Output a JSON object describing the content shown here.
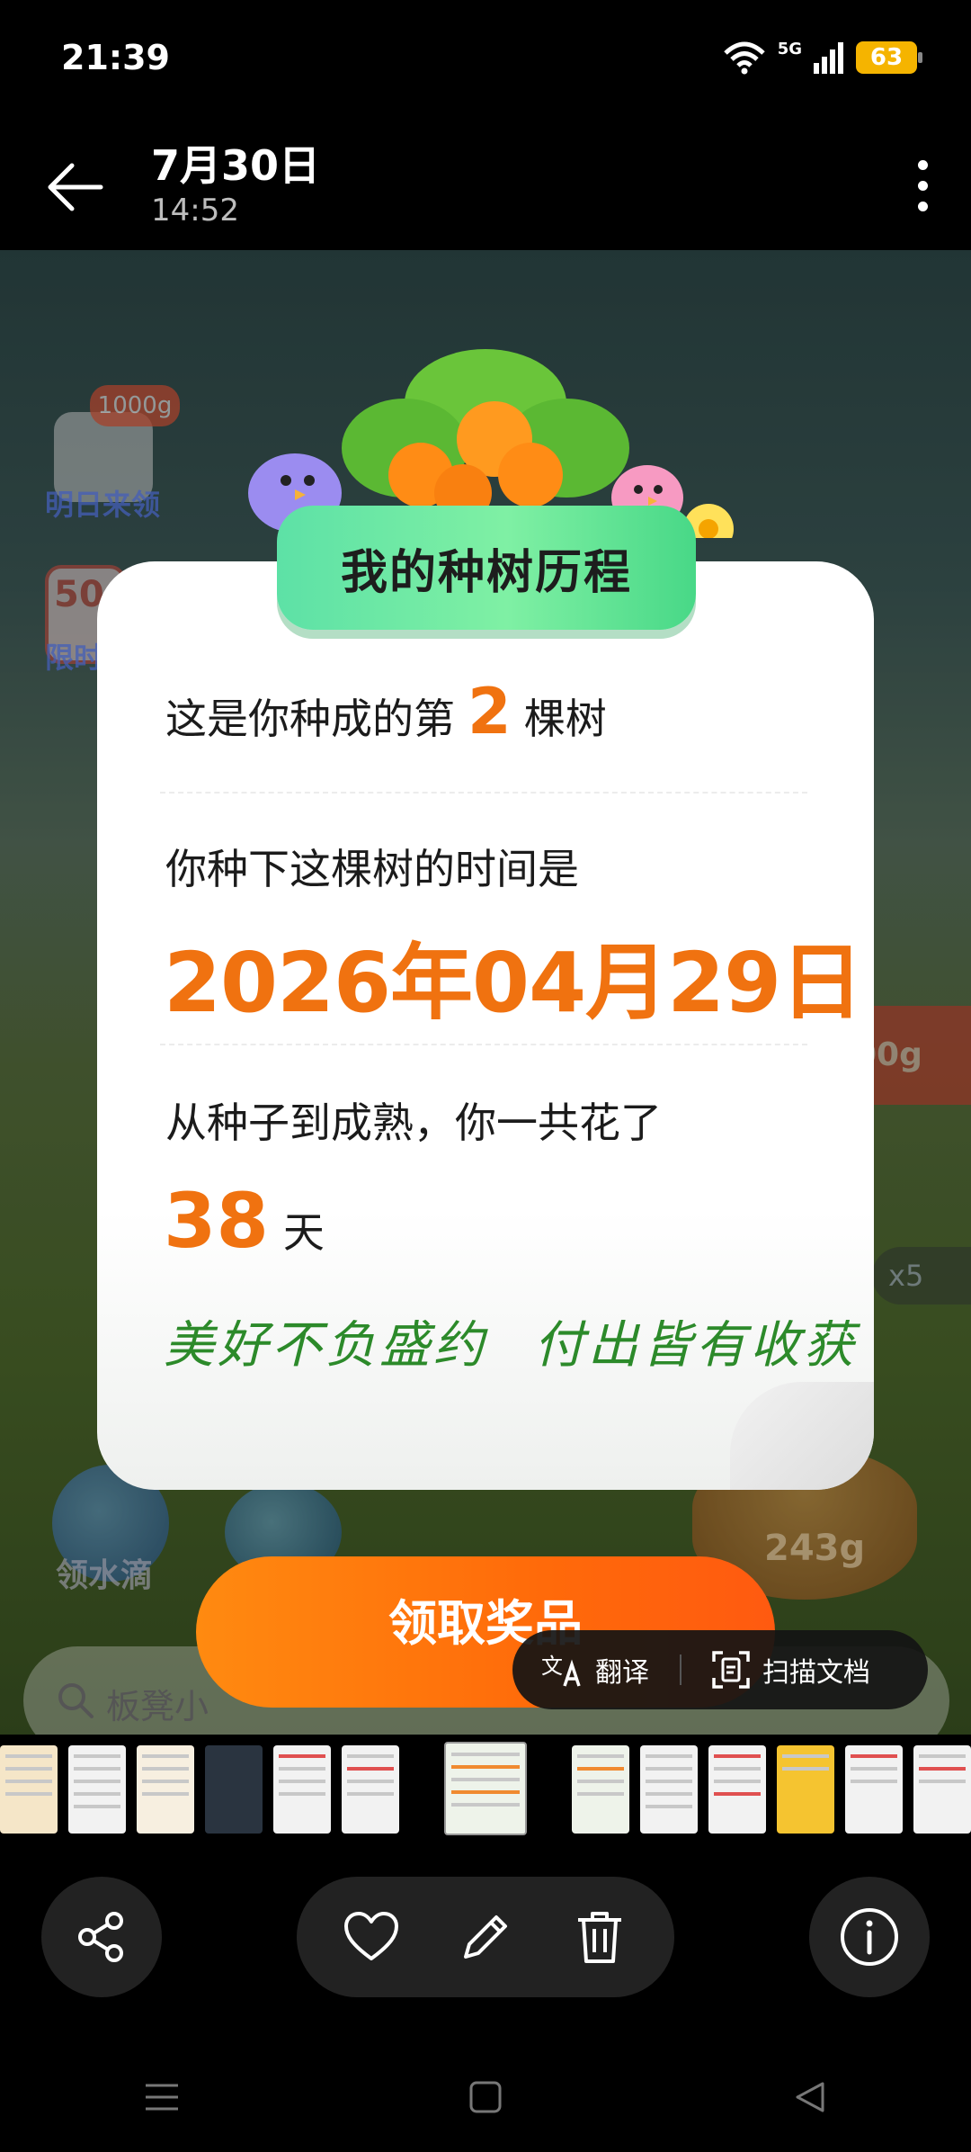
{
  "status_bar": {
    "time": "21:39",
    "network": "5G",
    "battery": "63"
  },
  "header": {
    "date": "7月30日",
    "time": "14:52"
  },
  "background": {
    "badge": "1000g",
    "label_tomorrow": "明日来领",
    "badge_50": "50",
    "label_limited": "限时",
    "badge_right": "00g",
    "multiplier": "x5",
    "label_water": "领水滴",
    "stump_value": "243g"
  },
  "card": {
    "title": "我的种树历程",
    "line1_prefix": "这是你种成的第",
    "line1_num": "2",
    "line1_suffix": "棵树",
    "line2": "你种下这棵树的时间是",
    "plant_date": "2026年04月29日",
    "line3": "从种子到成熟，你一共花了",
    "days_num": "38",
    "days_unit": "天",
    "motto": "美好不负盛约 付出皆有收获"
  },
  "claim_button": "领取奖品",
  "search": {
    "placeholder": "板凳小"
  },
  "float_bar": {
    "translate": "翻译",
    "scan": "扫描文档"
  },
  "colors": {
    "accent_orange": "#f07210",
    "banner_green": "#5de1a6",
    "motto_green": "#2c8a2a"
  },
  "toolbar": {
    "share": "share-icon",
    "favorite": "heart-icon",
    "edit": "pencil-icon",
    "delete": "trash-icon",
    "info": "info-icon"
  }
}
